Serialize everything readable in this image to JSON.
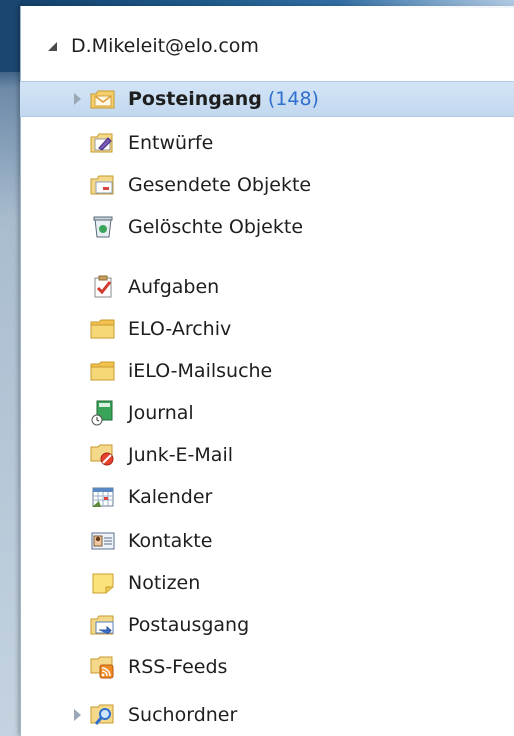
{
  "account": {
    "label": "D.Mikeleit@elo.com"
  },
  "folders": [
    {
      "label": "Posteingang",
      "count": "(148)",
      "icon": "inbox-icon",
      "selected": true,
      "expandable": true
    },
    {
      "label": "Entwürfe",
      "icon": "drafts-icon"
    },
    {
      "label": "Gesendete Objekte",
      "icon": "sent-items-icon"
    },
    {
      "label": "Gelöschte Objekte",
      "icon": "deleted-items-icon"
    },
    {
      "label": "Aufgaben",
      "icon": "tasks-icon"
    },
    {
      "label": "ELO-Archiv",
      "icon": "folder-icon"
    },
    {
      "label": "iELO-Mailsuche",
      "icon": "folder-icon"
    },
    {
      "label": "Journal",
      "icon": "journal-icon"
    },
    {
      "label": "Junk-E-Mail",
      "icon": "junk-mail-icon"
    },
    {
      "label": "Kalender",
      "icon": "calendar-icon"
    },
    {
      "label": "Kontakte",
      "icon": "contacts-icon"
    },
    {
      "label": "Notizen",
      "icon": "notes-icon"
    },
    {
      "label": "Postausgang",
      "icon": "outbox-icon"
    },
    {
      "label": "RSS-Feeds",
      "icon": "rss-feeds-icon"
    },
    {
      "label": "Suchordner",
      "icon": "search-folders-icon",
      "expandable": true
    }
  ],
  "colors": {
    "count": "#2f6fce",
    "selection": "#c8dcf1"
  }
}
